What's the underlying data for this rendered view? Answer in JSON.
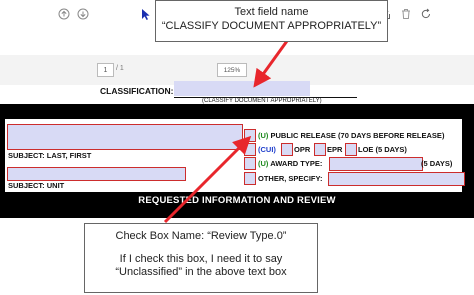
{
  "viewer": {
    "page_number": "1",
    "page_total": "/ 1",
    "zoom": "125%",
    "icons": [
      "arrow-up-icon",
      "arrow-down-icon",
      "cursor-icon",
      "hand-icon",
      "zoom-out-icon",
      "zoom-in-icon",
      "chevron-down-icon",
      "fit-page-icon",
      "download-icon",
      "comment-icon",
      "pen-icon",
      "sign-icon",
      "share-icon",
      "trash-icon",
      "undo-icon"
    ]
  },
  "form": {
    "classification_label": "CLASSIFICATION:",
    "classification_note": "(CLASSIFY DOCUMENT APPROPRIATELY)",
    "subject_name_label": "SUBJECT: LAST, FIRST",
    "subject_unit_label": "SUBJECT: UNIT",
    "options": {
      "public_release_marker": "(U)",
      "public_release_text": "PUBLIC RELEASE  (70 DAYS BEFORE RELEASE)",
      "cui_marker": "(CUI)",
      "opr": "OPR",
      "epr": "EPR",
      "loe": "LOE  (5 DAYS)",
      "award_marker": "(U)",
      "award_text": "AWARD TYPE:",
      "award_days": "(5 DAYS)",
      "other_text": "OTHER, SPECIFY:"
    },
    "section_title": "REQUESTED INFORMATION AND REVIEW"
  },
  "annotations": {
    "top_line1": "Text field name",
    "top_line2": "“CLASSIFY DOCUMENT APPROPRIATELY”",
    "bottom_line1": "Check Box Name: “Review Type.0”",
    "bottom_line2": "If I check this box, I need it to say",
    "bottom_line3": "“Unclassified” in the above text box",
    "arrow_color": "#e8262c"
  },
  "colors": {
    "field_fill": "#d8daf5",
    "field_border": "#cc2d2d",
    "marker_green": "#1f8a1f",
    "marker_blue": "#1f3fcc"
  }
}
